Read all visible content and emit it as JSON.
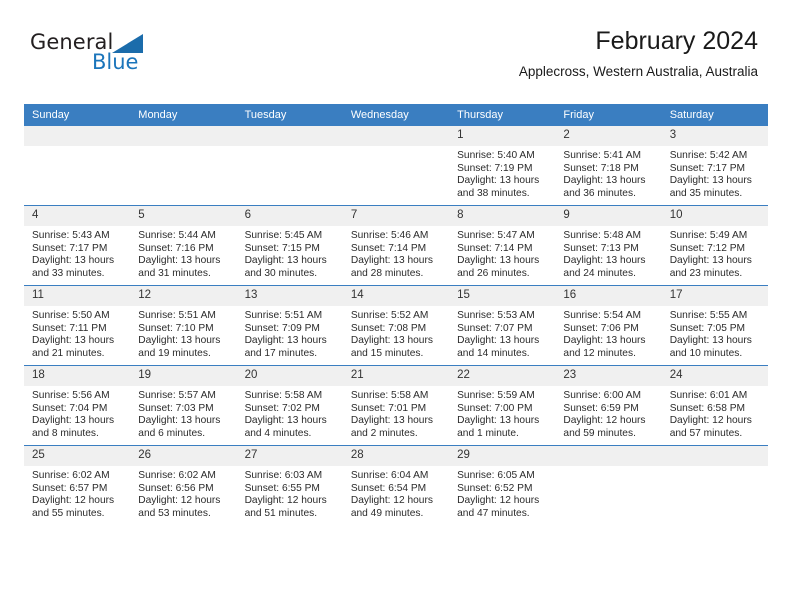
{
  "brand": {
    "name_top": "General",
    "name_bottom": "Blue",
    "accent_color": "#1b75bb"
  },
  "header": {
    "title": "February 2024",
    "subtitle": "Applecross, Western Australia, Australia"
  },
  "calendar": {
    "header_bg": "#3a7ec1",
    "daynum_bg": "#f0f0f0",
    "weekdays": [
      "Sunday",
      "Monday",
      "Tuesday",
      "Wednesday",
      "Thursday",
      "Friday",
      "Saturday"
    ],
    "weeks": [
      [
        {
          "day": "",
          "lines": []
        },
        {
          "day": "",
          "lines": []
        },
        {
          "day": "",
          "lines": []
        },
        {
          "day": "",
          "lines": []
        },
        {
          "day": "1",
          "lines": [
            "Sunrise: 5:40 AM",
            "Sunset: 7:19 PM",
            "Daylight: 13 hours and 38 minutes."
          ]
        },
        {
          "day": "2",
          "lines": [
            "Sunrise: 5:41 AM",
            "Sunset: 7:18 PM",
            "Daylight: 13 hours and 36 minutes."
          ]
        },
        {
          "day": "3",
          "lines": [
            "Sunrise: 5:42 AM",
            "Sunset: 7:17 PM",
            "Daylight: 13 hours and 35 minutes."
          ]
        }
      ],
      [
        {
          "day": "4",
          "lines": [
            "Sunrise: 5:43 AM",
            "Sunset: 7:17 PM",
            "Daylight: 13 hours and 33 minutes."
          ]
        },
        {
          "day": "5",
          "lines": [
            "Sunrise: 5:44 AM",
            "Sunset: 7:16 PM",
            "Daylight: 13 hours and 31 minutes."
          ]
        },
        {
          "day": "6",
          "lines": [
            "Sunrise: 5:45 AM",
            "Sunset: 7:15 PM",
            "Daylight: 13 hours and 30 minutes."
          ]
        },
        {
          "day": "7",
          "lines": [
            "Sunrise: 5:46 AM",
            "Sunset: 7:14 PM",
            "Daylight: 13 hours and 28 minutes."
          ]
        },
        {
          "day": "8",
          "lines": [
            "Sunrise: 5:47 AM",
            "Sunset: 7:14 PM",
            "Daylight: 13 hours and 26 minutes."
          ]
        },
        {
          "day": "9",
          "lines": [
            "Sunrise: 5:48 AM",
            "Sunset: 7:13 PM",
            "Daylight: 13 hours and 24 minutes."
          ]
        },
        {
          "day": "10",
          "lines": [
            "Sunrise: 5:49 AM",
            "Sunset: 7:12 PM",
            "Daylight: 13 hours and 23 minutes."
          ]
        }
      ],
      [
        {
          "day": "11",
          "lines": [
            "Sunrise: 5:50 AM",
            "Sunset: 7:11 PM",
            "Daylight: 13 hours and 21 minutes."
          ]
        },
        {
          "day": "12",
          "lines": [
            "Sunrise: 5:51 AM",
            "Sunset: 7:10 PM",
            "Daylight: 13 hours and 19 minutes."
          ]
        },
        {
          "day": "13",
          "lines": [
            "Sunrise: 5:51 AM",
            "Sunset: 7:09 PM",
            "Daylight: 13 hours and 17 minutes."
          ]
        },
        {
          "day": "14",
          "lines": [
            "Sunrise: 5:52 AM",
            "Sunset: 7:08 PM",
            "Daylight: 13 hours and 15 minutes."
          ]
        },
        {
          "day": "15",
          "lines": [
            "Sunrise: 5:53 AM",
            "Sunset: 7:07 PM",
            "Daylight: 13 hours and 14 minutes."
          ]
        },
        {
          "day": "16",
          "lines": [
            "Sunrise: 5:54 AM",
            "Sunset: 7:06 PM",
            "Daylight: 13 hours and 12 minutes."
          ]
        },
        {
          "day": "17",
          "lines": [
            "Sunrise: 5:55 AM",
            "Sunset: 7:05 PM",
            "Daylight: 13 hours and 10 minutes."
          ]
        }
      ],
      [
        {
          "day": "18",
          "lines": [
            "Sunrise: 5:56 AM",
            "Sunset: 7:04 PM",
            "Daylight: 13 hours and 8 minutes."
          ]
        },
        {
          "day": "19",
          "lines": [
            "Sunrise: 5:57 AM",
            "Sunset: 7:03 PM",
            "Daylight: 13 hours and 6 minutes."
          ]
        },
        {
          "day": "20",
          "lines": [
            "Sunrise: 5:58 AM",
            "Sunset: 7:02 PM",
            "Daylight: 13 hours and 4 minutes."
          ]
        },
        {
          "day": "21",
          "lines": [
            "Sunrise: 5:58 AM",
            "Sunset: 7:01 PM",
            "Daylight: 13 hours and 2 minutes."
          ]
        },
        {
          "day": "22",
          "lines": [
            "Sunrise: 5:59 AM",
            "Sunset: 7:00 PM",
            "Daylight: 13 hours and 1 minute."
          ]
        },
        {
          "day": "23",
          "lines": [
            "Sunrise: 6:00 AM",
            "Sunset: 6:59 PM",
            "Daylight: 12 hours and 59 minutes."
          ]
        },
        {
          "day": "24",
          "lines": [
            "Sunrise: 6:01 AM",
            "Sunset: 6:58 PM",
            "Daylight: 12 hours and 57 minutes."
          ]
        }
      ],
      [
        {
          "day": "25",
          "lines": [
            "Sunrise: 6:02 AM",
            "Sunset: 6:57 PM",
            "Daylight: 12 hours and 55 minutes."
          ]
        },
        {
          "day": "26",
          "lines": [
            "Sunrise: 6:02 AM",
            "Sunset: 6:56 PM",
            "Daylight: 12 hours and 53 minutes."
          ]
        },
        {
          "day": "27",
          "lines": [
            "Sunrise: 6:03 AM",
            "Sunset: 6:55 PM",
            "Daylight: 12 hours and 51 minutes."
          ]
        },
        {
          "day": "28",
          "lines": [
            "Sunrise: 6:04 AM",
            "Sunset: 6:54 PM",
            "Daylight: 12 hours and 49 minutes."
          ]
        },
        {
          "day": "29",
          "lines": [
            "Sunrise: 6:05 AM",
            "Sunset: 6:52 PM",
            "Daylight: 12 hours and 47 minutes."
          ]
        },
        {
          "day": "",
          "lines": []
        },
        {
          "day": "",
          "lines": []
        }
      ]
    ]
  }
}
